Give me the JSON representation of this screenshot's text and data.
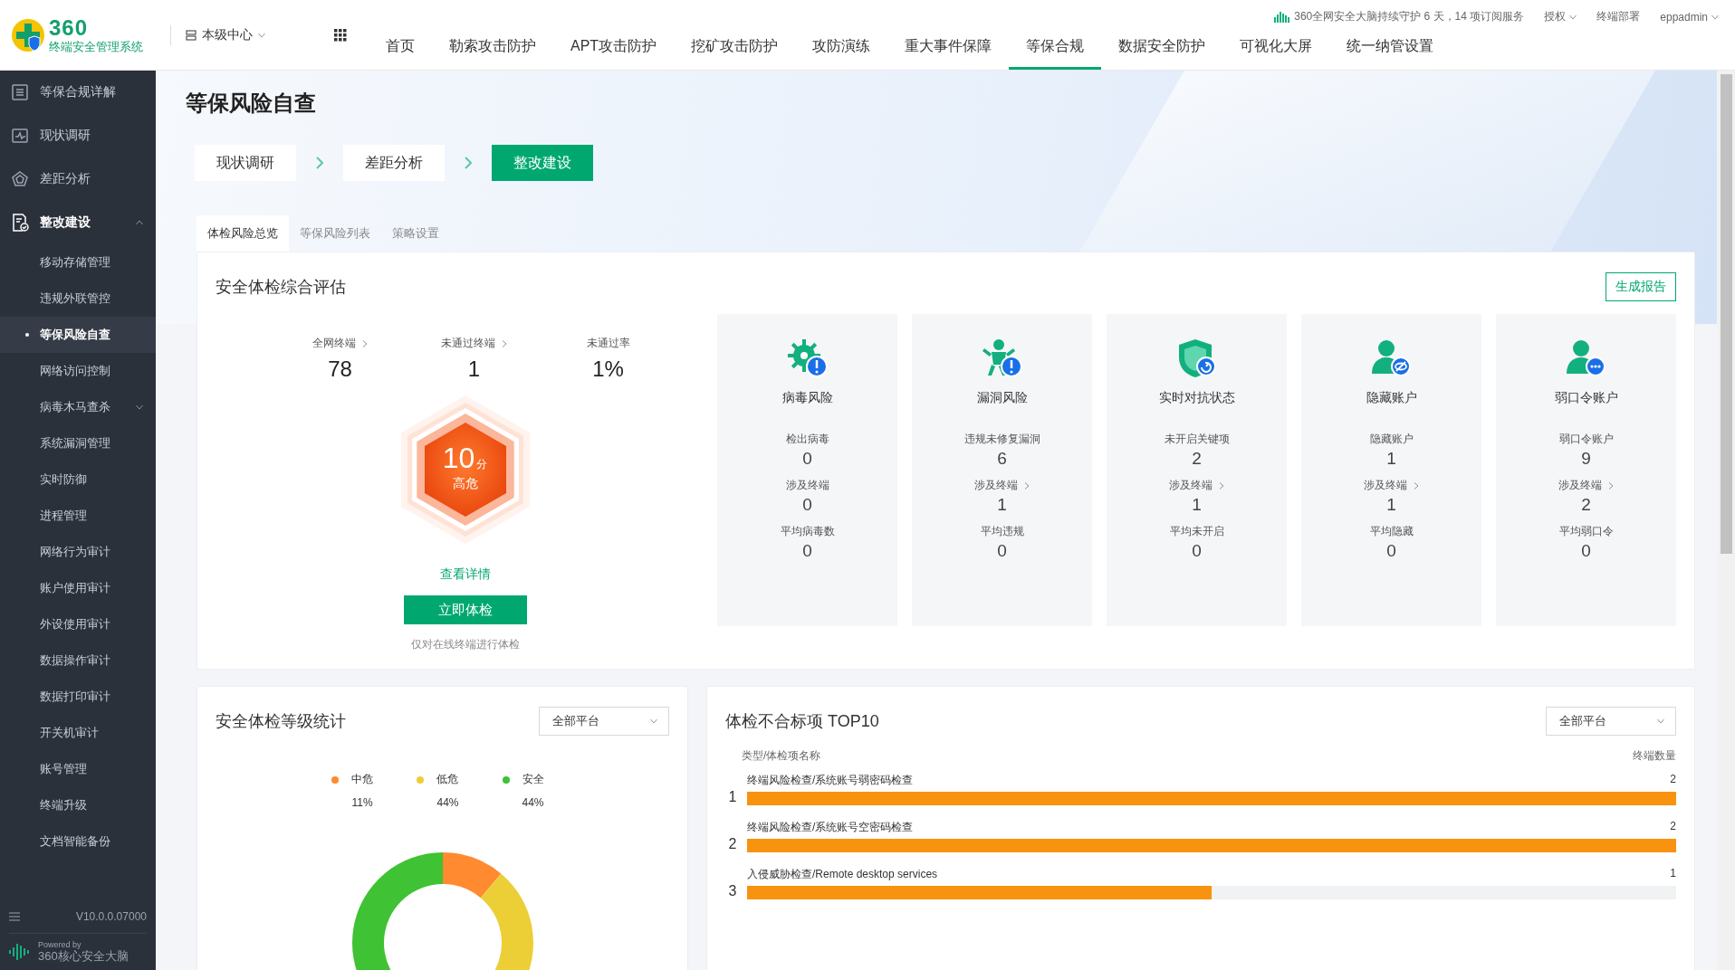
{
  "header": {
    "logo_text": "360",
    "logo_subtitle": "终端安全管理系统",
    "center": "本级中心",
    "nav": [
      {
        "label": "首页",
        "selected": false
      },
      {
        "label": "勒索攻击防护",
        "selected": false
      },
      {
        "label": "APT攻击防护",
        "selected": false
      },
      {
        "label": "挖矿攻击防护",
        "selected": false
      },
      {
        "label": "攻防演练",
        "selected": false
      },
      {
        "label": "重大事件保障",
        "selected": false
      },
      {
        "label": "等保合规",
        "selected": true
      },
      {
        "label": "数据安全防护",
        "selected": false
      },
      {
        "label": "可视化大屏",
        "selected": false
      },
      {
        "label": "统一纳管设置",
        "selected": false
      }
    ],
    "status": "360全网安全大脑持续守护 6 天，14 项订阅服务",
    "license": "授权",
    "deploy": "终端部署",
    "user": "eppadmin"
  },
  "sidebar": {
    "items": [
      {
        "label": "等保合规详解",
        "kind": "list",
        "selected": false
      },
      {
        "label": "现状调研",
        "kind": "chart",
        "selected": false
      },
      {
        "label": "差距分析",
        "kind": "pentagon",
        "selected": false
      },
      {
        "label": "整改建设",
        "kind": "doc",
        "selected": true,
        "expanded": true,
        "children": [
          {
            "label": "移动存储管理",
            "selected": false
          },
          {
            "label": "违规外联管控",
            "selected": false
          },
          {
            "label": "等保风险自查",
            "selected": true
          },
          {
            "label": "网络访问控制",
            "selected": false
          },
          {
            "label": "病毒木马查杀",
            "selected": false,
            "expanded": false
          },
          {
            "label": "系统漏洞管理",
            "selected": false
          },
          {
            "label": "实时防御",
            "selected": false
          },
          {
            "label": "进程管理",
            "selected": false
          },
          {
            "label": "网络行为审计",
            "selected": false
          },
          {
            "label": "账户使用审计",
            "selected": false
          },
          {
            "label": "外设使用审计",
            "selected": false
          },
          {
            "label": "数据操作审计",
            "selected": false
          },
          {
            "label": "数据打印审计",
            "selected": false
          },
          {
            "label": "开关机审计",
            "selected": false
          },
          {
            "label": "账号管理",
            "selected": false
          },
          {
            "label": "终端升级",
            "selected": false
          },
          {
            "label": "文档智能备份",
            "selected": false
          }
        ]
      }
    ],
    "version": "V10.0.0.07000",
    "powered_by": "Powered by",
    "brand": "360核心安全大脑"
  },
  "page": {
    "title": "等保风险自查",
    "steps": [
      {
        "label": "现状调研",
        "selected": false
      },
      {
        "label": "差距分析",
        "selected": false
      },
      {
        "label": "整改建设",
        "selected": true
      }
    ],
    "tabs": [
      {
        "label": "体检风险总览",
        "selected": true
      },
      {
        "label": "等保风险列表",
        "selected": false
      },
      {
        "label": "策略设置",
        "selected": false
      }
    ]
  },
  "assessment": {
    "title": "安全体检综合评估",
    "report_button": "生成报告",
    "stats": [
      {
        "label": "全网终端",
        "value": "78",
        "link": true
      },
      {
        "label": "未通过终端",
        "value": "1",
        "link": true
      },
      {
        "label": "未通过率",
        "value": "1%",
        "link": false
      }
    ],
    "score": "10",
    "score_unit": "分",
    "score_level": "高危",
    "details_link": "查看详情",
    "check_button": "立即体检",
    "note": "仅对在线终端进行体检",
    "risks": [
      {
        "title": "病毒风险",
        "kind": "gear",
        "metrics": [
          {
            "label": "检出病毒",
            "value": "0",
            "link": false
          },
          {
            "label": "涉及终端",
            "value": "0",
            "link": false
          },
          {
            "label": "平均病毒数",
            "value": "0",
            "link": false
          }
        ]
      },
      {
        "title": "漏洞风险",
        "kind": "figure",
        "metrics": [
          {
            "label": "违规未修复漏洞",
            "value": "6",
            "link": false
          },
          {
            "label": "涉及终端",
            "value": "1",
            "link": true
          },
          {
            "label": "平均违规",
            "value": "0",
            "link": false
          }
        ]
      },
      {
        "title": "实时对抗状态",
        "kind": "shield",
        "metrics": [
          {
            "label": "未开启关键项",
            "value": "2",
            "link": false
          },
          {
            "label": "涉及终端",
            "value": "1",
            "link": true
          },
          {
            "label": "平均未开启",
            "value": "0",
            "link": false
          }
        ]
      },
      {
        "title": "隐藏账户",
        "kind": "hidden-user",
        "metrics": [
          {
            "label": "隐藏账户",
            "value": "1",
            "link": false
          },
          {
            "label": "涉及终端",
            "value": "1",
            "link": true
          },
          {
            "label": "平均隐藏",
            "value": "0",
            "link": false
          }
        ]
      },
      {
        "title": "弱口令账户",
        "kind": "password-user",
        "metrics": [
          {
            "label": "弱口令账户",
            "value": "9",
            "link": false
          },
          {
            "label": "涉及终端",
            "value": "2",
            "link": true
          },
          {
            "label": "平均弱口令",
            "value": "0",
            "link": false
          }
        ]
      }
    ]
  },
  "level_stats": {
    "title": "安全体检等级统计",
    "platform": "全部平台",
    "chart_data": {
      "type": "donut",
      "categories": [
        "中危",
        "低危",
        "安全"
      ],
      "values": [
        11,
        44,
        44
      ],
      "value_labels": [
        "11%",
        "44%",
        "44%"
      ],
      "colors": [
        "#ff8a30",
        "#ecce37",
        "#3fc233"
      ],
      "legend": "top"
    }
  },
  "top10": {
    "title": "体检不合标项 TOP10",
    "platform": "全部平台",
    "col_name": "类型/体检项名称",
    "col_count": "终端数量",
    "rows": [
      {
        "rank": "1",
        "name": "终端风险检查/系统账号弱密码检查",
        "count": "2",
        "level": 1
      },
      {
        "rank": "2",
        "name": "终端风险检查/系统账号空密码检查",
        "count": "2",
        "level": 1
      },
      {
        "rank": "3",
        "name": "入侵威胁检查/Remote desktop services",
        "count": "1",
        "level": 0.5
      }
    ]
  }
}
